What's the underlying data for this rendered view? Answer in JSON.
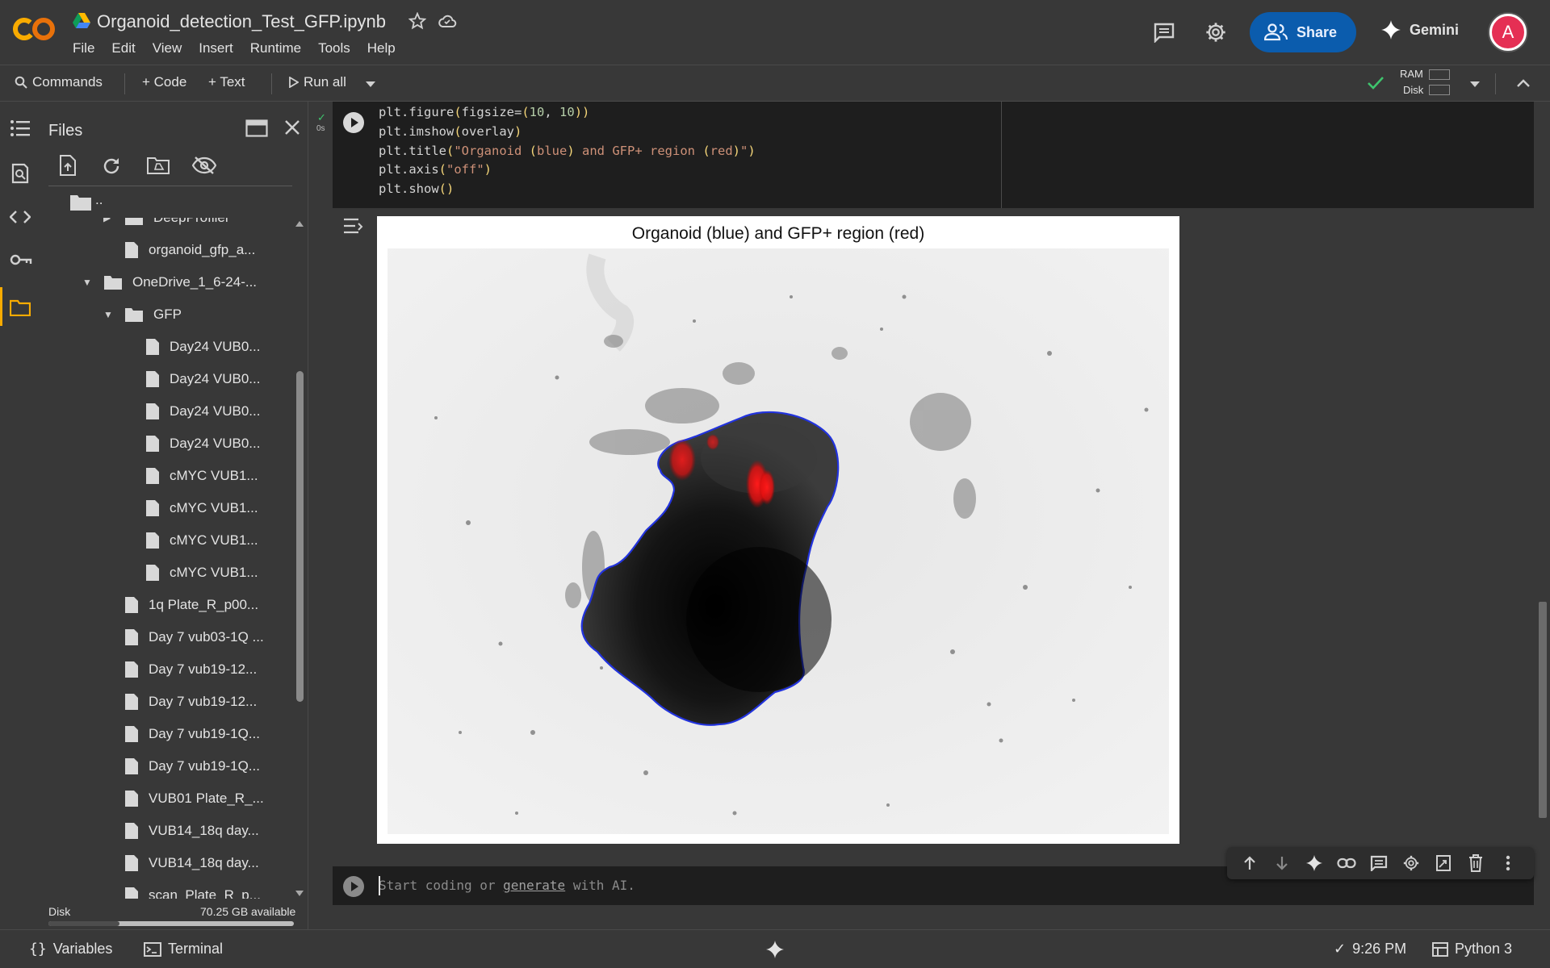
{
  "header": {
    "notebook_title": "Organoid_detection_Test_GFP.ipynb",
    "menu": [
      "File",
      "Edit",
      "View",
      "Insert",
      "Runtime",
      "Tools",
      "Help"
    ],
    "share_label": "Share",
    "gemini_label": "Gemini",
    "avatar_initial": "A"
  },
  "toolbar": {
    "commands_label": "Commands",
    "code_label": "+ Code",
    "text_label": "+ Text",
    "run_all_label": "Run all",
    "ram_label": "RAM",
    "disk_label": "Disk"
  },
  "files_panel": {
    "title": "Files",
    "parent_dir": "..",
    "items": [
      {
        "label": "DeepProfiler",
        "type": "folder",
        "expanded": false,
        "depth": 2
      },
      {
        "label": "organoid_gfp_a...",
        "type": "file",
        "depth": 2
      },
      {
        "label": "OneDrive_1_6-24-...",
        "type": "folder",
        "expanded": true,
        "depth": 1
      },
      {
        "label": "GFP",
        "type": "folder",
        "expanded": true,
        "depth": 2
      },
      {
        "label": "Day24 VUB0...",
        "type": "file",
        "depth": 3
      },
      {
        "label": "Day24 VUB0...",
        "type": "file",
        "depth": 3
      },
      {
        "label": "Day24 VUB0...",
        "type": "file",
        "depth": 3
      },
      {
        "label": "Day24 VUB0...",
        "type": "file",
        "depth": 3
      },
      {
        "label": "cMYC VUB1...",
        "type": "file",
        "depth": 3
      },
      {
        "label": "cMYC VUB1...",
        "type": "file",
        "depth": 3
      },
      {
        "label": "cMYC VUB1...",
        "type": "file",
        "depth": 3
      },
      {
        "label": "cMYC VUB1...",
        "type": "file",
        "depth": 3
      },
      {
        "label": "1q Plate_R_p00...",
        "type": "file",
        "depth": 2
      },
      {
        "label": "Day 7 vub03-1Q ...",
        "type": "file",
        "depth": 2
      },
      {
        "label": "Day 7 vub19-12...",
        "type": "file",
        "depth": 2
      },
      {
        "label": "Day 7 vub19-12...",
        "type": "file",
        "depth": 2
      },
      {
        "label": "Day 7 vub19-1Q...",
        "type": "file",
        "depth": 2
      },
      {
        "label": "Day 7 vub19-1Q...",
        "type": "file",
        "depth": 2
      },
      {
        "label": "VUB01 Plate_R_...",
        "type": "file",
        "depth": 2
      },
      {
        "label": "VUB14_18q day...",
        "type": "file",
        "depth": 2
      },
      {
        "label": "VUB14_18q day...",
        "type": "file",
        "depth": 2
      },
      {
        "label": "scan_Plate_R_p...",
        "type": "file",
        "depth": 2
      }
    ],
    "disk_label": "Disk",
    "disk_available": "70.25 GB available",
    "disk_used_fraction": 0.29
  },
  "code_cell": {
    "exec_time": "0s",
    "lines": [
      "plt.figure(figsize=(10, 10))",
      "plt.imshow(overlay)",
      "plt.title(\"Organoid (blue) and GFP+ region (red)\")",
      "plt.axis(\"off\")",
      "plt.show()"
    ]
  },
  "output": {
    "figure_title": "Organoid (blue) and GFP+ region (red)"
  },
  "empty_cell": {
    "placeholder_start": "Start coding or ",
    "placeholder_link": "generate",
    "placeholder_end": " with AI."
  },
  "statusbar": {
    "variables_label": "Variables",
    "terminal_label": "Terminal",
    "time": "9:26 PM",
    "runtime": "Python 3"
  },
  "colors": {
    "background": "#383838",
    "cell_bg": "#1e1e1e",
    "share_blue": "#0b5cad",
    "accent_orange": "#f9ab00",
    "avatar": "#e52f54",
    "organoid_outline": "#2233dd",
    "gfp_red": "#ff1a1a"
  }
}
